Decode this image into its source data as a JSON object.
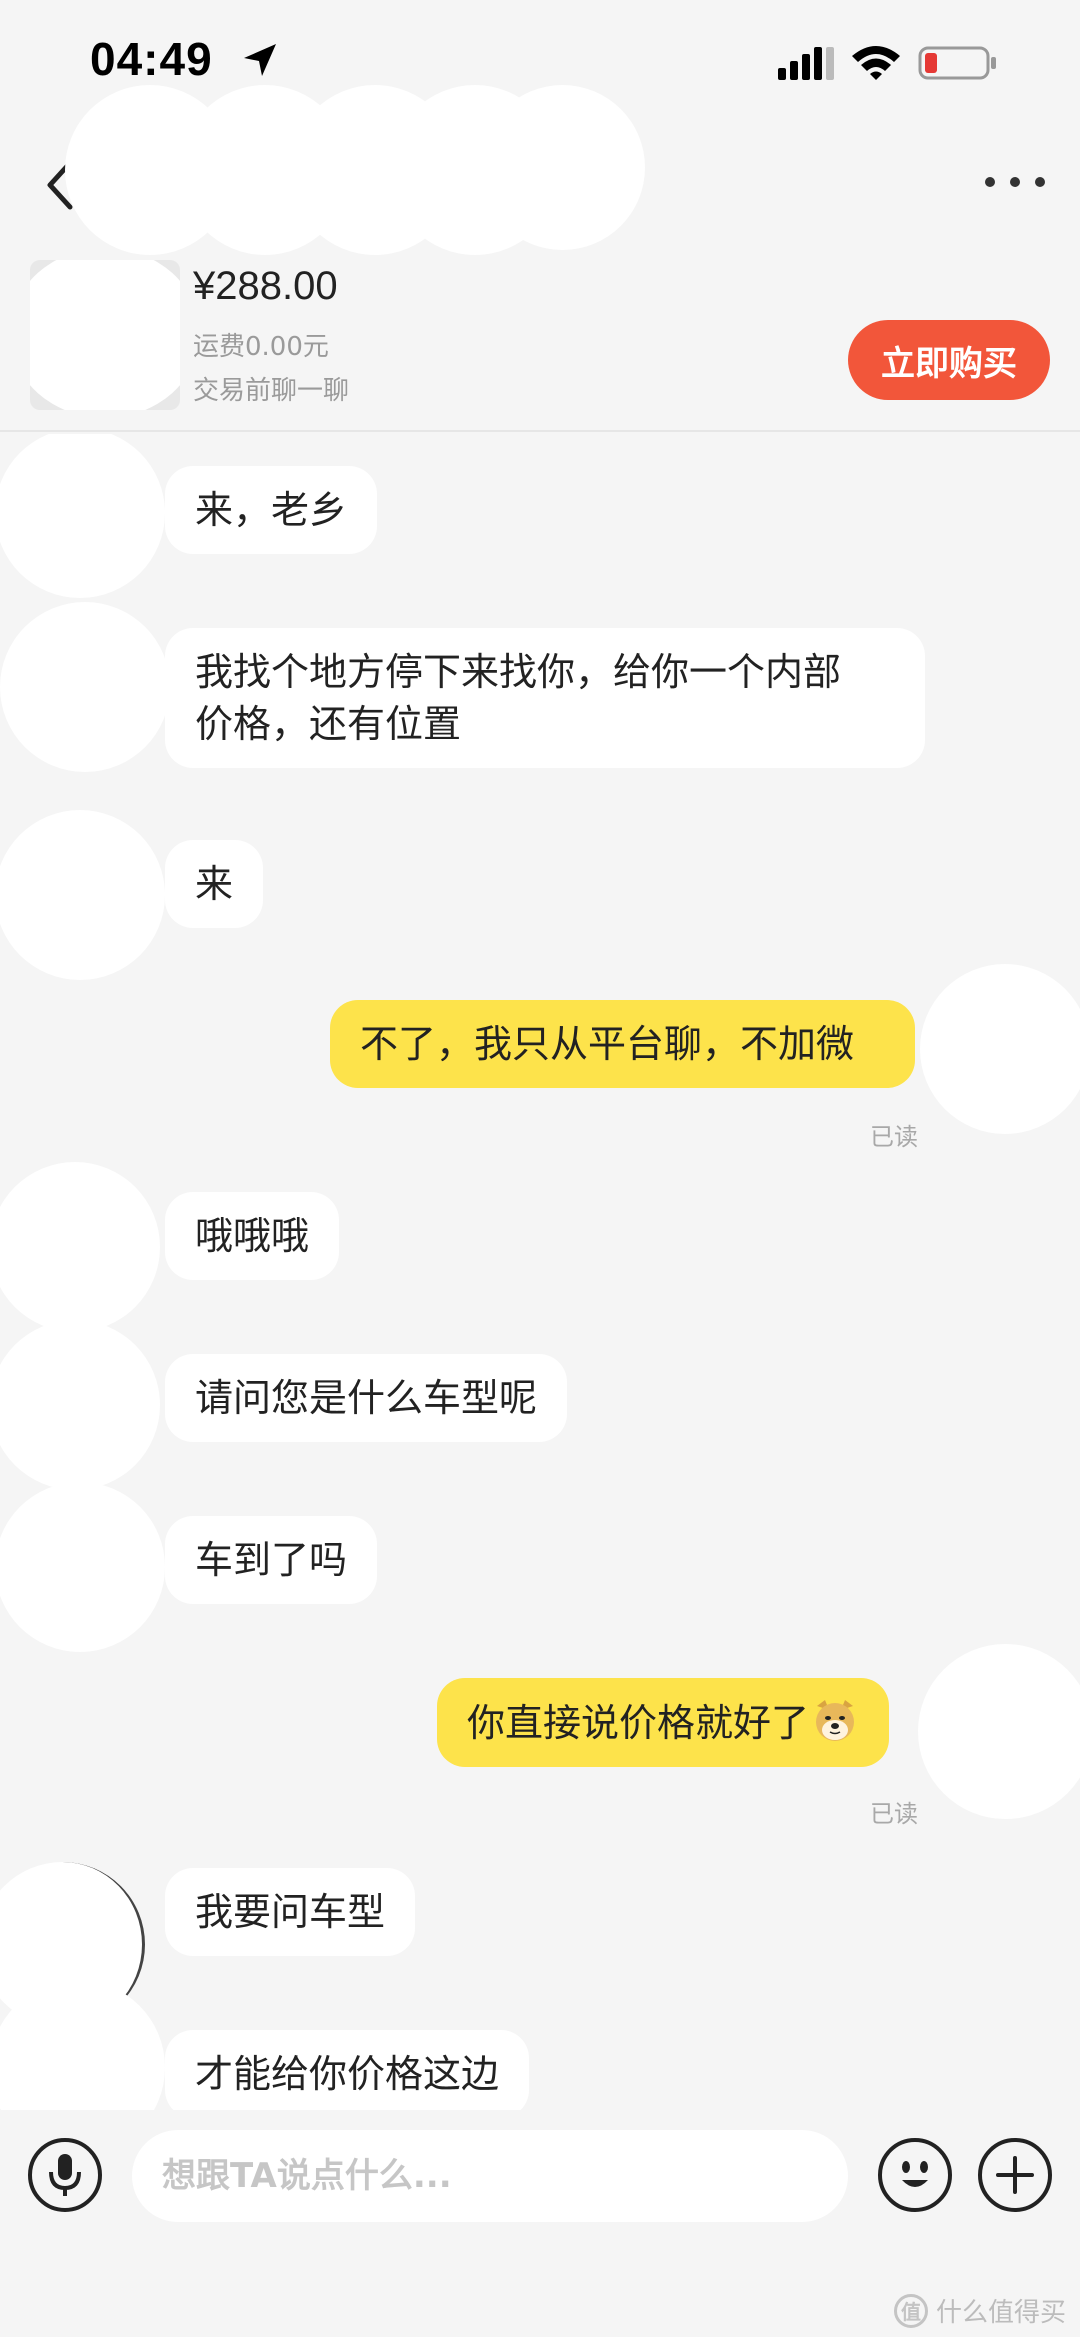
{
  "status_bar": {
    "time": "04:49",
    "battery_color": "#e53935"
  },
  "nav": {
    "back_icon": "chevron-left-icon",
    "more_icon": "more-dots-icon"
  },
  "product": {
    "price": "¥288.00",
    "shipping": "运费0.00元",
    "chat_hint": "交易前聊一聊",
    "buy_label": "立即购买",
    "buy_color": "#f2563a"
  },
  "messages": [
    {
      "side": "left",
      "text": "来，老乡"
    },
    {
      "side": "left",
      "text": "我找个地方停下来找你，给你一个内部\n价格，还有位置"
    },
    {
      "side": "left",
      "text": "来"
    },
    {
      "side": "right",
      "text": "不了，我只从平台聊，不加微",
      "receipt": "已读"
    },
    {
      "side": "left",
      "text": "哦哦哦"
    },
    {
      "side": "left",
      "text": "请问您是什么车型呢"
    },
    {
      "side": "left",
      "text": "车到了吗"
    },
    {
      "side": "right",
      "text": "你直接说价格就好了",
      "emoji": "doge-emoji",
      "receipt": "已读"
    },
    {
      "side": "left",
      "text": "我要问车型"
    },
    {
      "side": "left",
      "text": "才能给你价格这边"
    }
  ],
  "input": {
    "placeholder": "想跟TA说点什么...",
    "mic_icon": "microphone-icon",
    "emoji_icon": "smiley-icon",
    "plus_icon": "plus-icon"
  },
  "watermark": {
    "text": "什么值得买",
    "logo": "值"
  },
  "colors": {
    "my_bubble": "#fde34b",
    "their_bubble": "#ffffff",
    "background": "#f5f5f5"
  }
}
